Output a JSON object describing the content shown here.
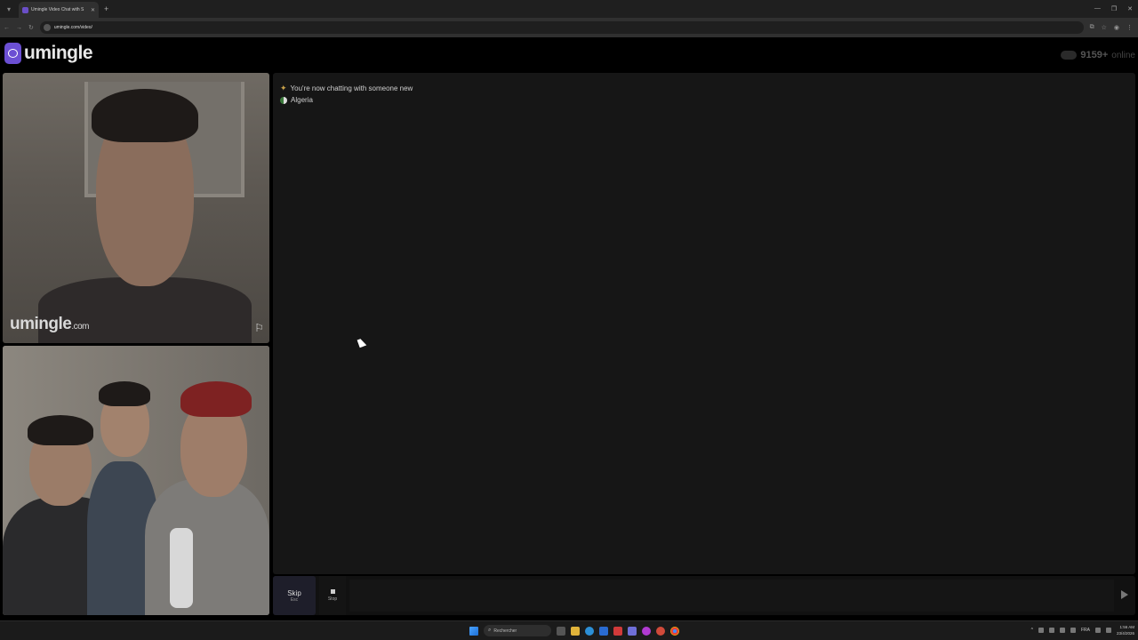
{
  "browser": {
    "tab_title": "Umingle Video Chat with S",
    "url": "umingle.com/video/"
  },
  "site": {
    "logo_text": "umingle",
    "online_count": "9159+",
    "online_label": "online",
    "accent_color": "#6b4fd3"
  },
  "stranger_video": {
    "watermark": "umingle",
    "watermark_suffix": ".com"
  },
  "chat": {
    "messages": [
      {
        "icon": "sparkle-icon",
        "text": "You're now chatting with someone new"
      },
      {
        "icon": "globe-icon",
        "text": "Algeria"
      }
    ],
    "input_value": ""
  },
  "controls": {
    "skip_label": "Skip",
    "skip_key": "Esc",
    "stop_label": "Stop"
  },
  "taskbar": {
    "search_placeholder": "Rechercher",
    "tray_lang": "FRA",
    "time": "1:56 AM",
    "date": "23/4/2026"
  }
}
